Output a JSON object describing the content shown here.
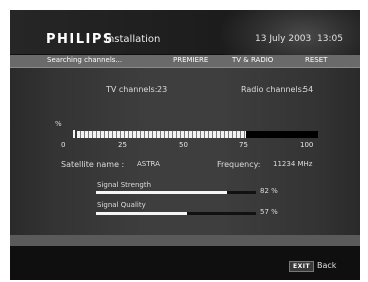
{
  "header": {
    "brand": "PHILIPS",
    "title": "Installation",
    "date": "13 July 2003",
    "time": "13:05"
  },
  "menubar": {
    "status": "Searching channels...",
    "items": [
      "PREMIERE",
      "TV & RADIO",
      "RESET"
    ]
  },
  "search": {
    "tv_channels_label": "TV channels:",
    "tv_channels_value": "23",
    "radio_channels_label": "Radio channels:",
    "radio_channels_value": "54",
    "progress_unit": "%",
    "progress_percent": 70,
    "progress_ticks": [
      "0",
      "25",
      "50",
      "75",
      "100"
    ],
    "satellite_label": "Satellite name :",
    "satellite_value": "ASTRA",
    "frequency_label": "Frequency:",
    "frequency_value": "11234 MHz"
  },
  "signal": {
    "strength_label": "Signal Strength",
    "strength_value": "82 %",
    "strength_percent": 82,
    "quality_label": "Signal Quality",
    "quality_value": "57 %",
    "quality_percent": 57
  },
  "footer": {
    "exit_key": "EXIT",
    "back_label": "Back"
  }
}
